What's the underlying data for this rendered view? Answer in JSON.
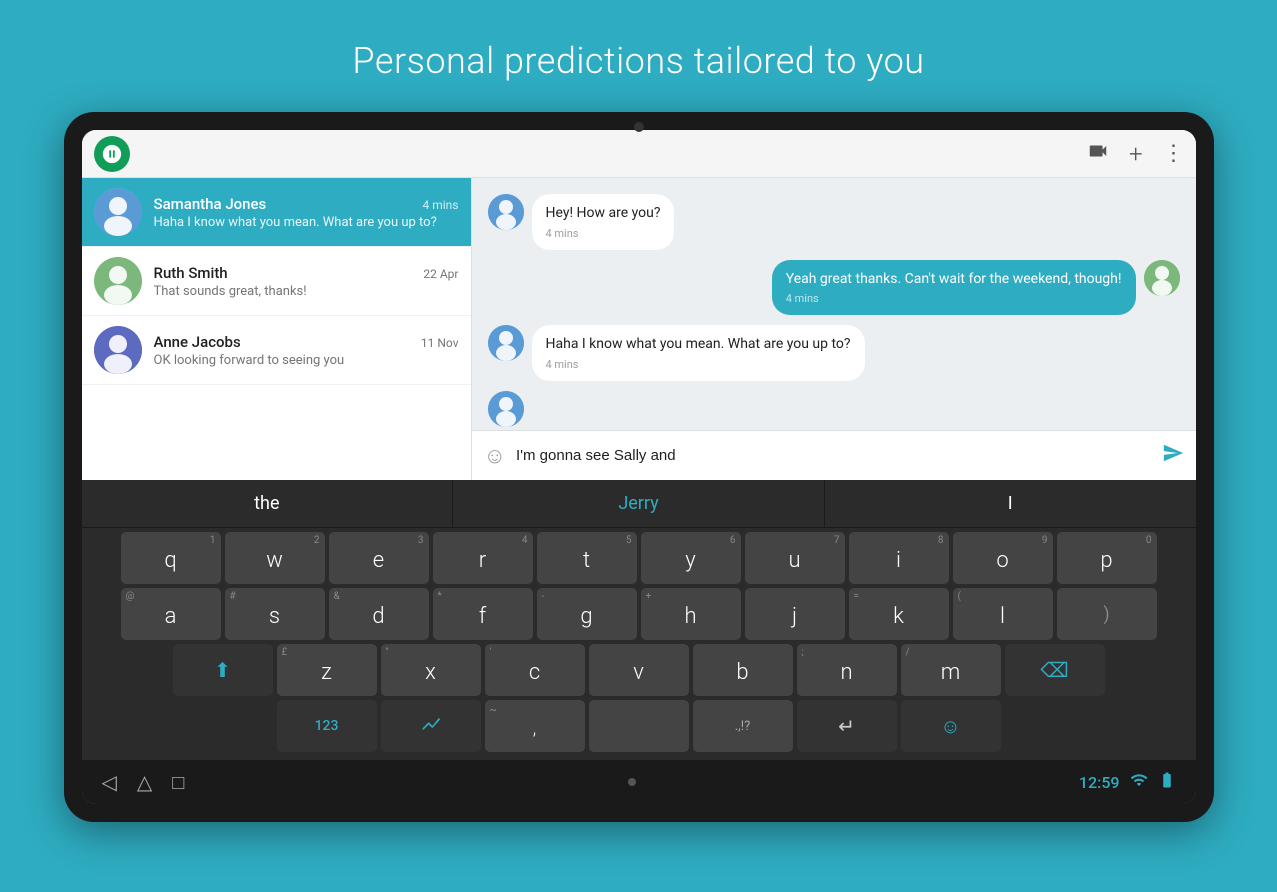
{
  "page": {
    "title": "Personal predictions tailored to you",
    "background_color": "#2eacc1"
  },
  "app_header": {
    "video_icon": "📹",
    "add_icon": "+",
    "more_icon": "⋮"
  },
  "conversations": [
    {
      "id": "samantha",
      "name": "Samantha Jones",
      "time": "4 mins",
      "preview": "Haha I know what you mean. What are you up to?",
      "active": true
    },
    {
      "id": "ruth",
      "name": "Ruth Smith",
      "time": "22 Apr",
      "preview": "That sounds great, thanks!",
      "active": false
    },
    {
      "id": "anne",
      "name": "Anne Jacobs",
      "time": "11 Nov",
      "preview": "OK looking forward to seeing you",
      "active": false
    }
  ],
  "messages": [
    {
      "id": 1,
      "type": "incoming",
      "text": "Hey! How are you?",
      "time": "4 mins",
      "sender": "samantha"
    },
    {
      "id": 2,
      "type": "outgoing",
      "text": "Yeah great thanks. Can't wait for the weekend, though!",
      "time": "4 mins",
      "sender": "me"
    },
    {
      "id": 3,
      "type": "incoming",
      "text": "Haha I know what you mean. What are you up to?",
      "time": "4 mins",
      "sender": "samantha"
    },
    {
      "id": 4,
      "type": "incoming",
      "text": "",
      "time": "",
      "sender": "samantha_avatar_only"
    }
  ],
  "input": {
    "current_text": "I'm gonna see Sally and",
    "placeholder": "",
    "emoji_icon": "☺",
    "send_icon": "➤"
  },
  "predictions": [
    {
      "text": "the",
      "highlight": false
    },
    {
      "text": "Jerry",
      "highlight": true
    },
    {
      "text": "I",
      "highlight": false
    }
  ],
  "keyboard": {
    "rows": [
      {
        "keys": [
          {
            "letter": "q",
            "number": "1",
            "symbol": ""
          },
          {
            "letter": "w",
            "number": "2",
            "symbol": ""
          },
          {
            "letter": "e",
            "number": "3",
            "symbol": ""
          },
          {
            "letter": "r",
            "number": "4",
            "symbol": ""
          },
          {
            "letter": "t",
            "number": "5",
            "symbol": ""
          },
          {
            "letter": "y",
            "number": "6",
            "symbol": ""
          },
          {
            "letter": "u",
            "number": "7",
            "symbol": ""
          },
          {
            "letter": "i",
            "number": "8",
            "symbol": ""
          },
          {
            "letter": "o",
            "number": "9",
            "symbol": ""
          },
          {
            "letter": "p",
            "number": "0",
            "symbol": ""
          }
        ]
      },
      {
        "keys": [
          {
            "letter": "a",
            "number": "",
            "symbol": "@"
          },
          {
            "letter": "s",
            "number": "",
            "symbol": "#"
          },
          {
            "letter": "d",
            "number": "",
            "symbol": "&"
          },
          {
            "letter": "f",
            "number": "",
            "symbol": "*"
          },
          {
            "letter": "g",
            "number": "",
            "symbol": "-"
          },
          {
            "letter": "h",
            "number": "",
            "symbol": "+"
          },
          {
            "letter": "j",
            "number": "",
            "symbol": ""
          },
          {
            "letter": "k",
            "number": "",
            "symbol": "="
          },
          {
            "letter": "l",
            "number": "",
            "symbol": "("
          },
          {
            "letter": "",
            "number": "",
            "symbol": ")"
          }
        ]
      },
      {
        "keys": [
          {
            "letter": "shift",
            "special": true
          },
          {
            "letter": "z",
            "number": "",
            "symbol": "£"
          },
          {
            "letter": "x",
            "number": "",
            "symbol": "\""
          },
          {
            "letter": "c",
            "number": "",
            "symbol": "'"
          },
          {
            "letter": "v",
            "number": "",
            "symbol": ""
          },
          {
            "letter": "b",
            "number": "",
            "symbol": ""
          },
          {
            "letter": "n",
            "number": "",
            "symbol": ";"
          },
          {
            "letter": "m",
            "number": "",
            "symbol": "/"
          },
          {
            "letter": "backspace",
            "special": true
          }
        ]
      },
      {
        "keys": [
          {
            "letter": "123",
            "special": true
          },
          {
            "letter": "swift_icon",
            "special": true
          },
          {
            "letter": "comma",
            "symbol": ","
          },
          {
            "letter": "space",
            "wide": true
          },
          {
            "letter": "punctuation",
            "symbol": ".,!?"
          },
          {
            "letter": "enter",
            "special": true
          },
          {
            "letter": "emoji",
            "special": true
          }
        ]
      }
    ],
    "bottom_nav": {
      "back_icon": "◁",
      "home_icon": "△",
      "square_icon": "□",
      "time": "12:59",
      "wifi_icon": "wifi",
      "battery_icon": "battery"
    }
  }
}
